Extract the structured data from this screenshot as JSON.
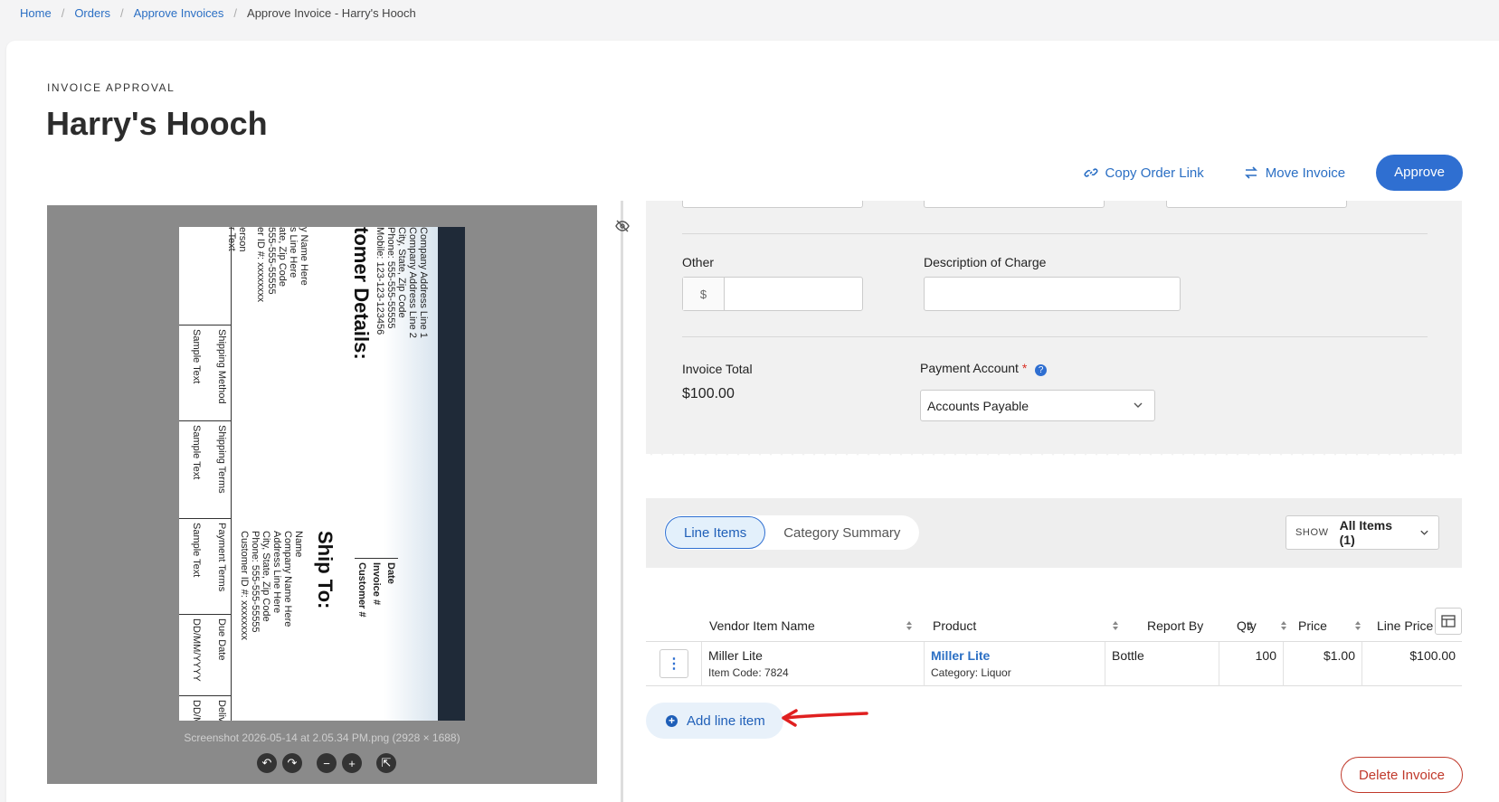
{
  "breadcrumb": {
    "items": [
      "Home",
      "Orders",
      "Approve Invoices"
    ],
    "current": "Approve Invoice - Harry's Hooch"
  },
  "header": {
    "eyebrow": "INVOICE APPROVAL",
    "title": "Harry's Hooch"
  },
  "actions": {
    "copy_link": "Copy Order Link",
    "move_invoice": "Move Invoice",
    "approve": "Approve"
  },
  "viewer": {
    "caption": "Screenshot 2026-05-14 at 2.05.34 PM.png (2928 × 1688)",
    "doc_heading_1": "tomer Details:",
    "doc_heading_2": "Ship To:",
    "doc_lines_left": [
      "Company Address Line 1",
      "Company Address Line 2",
      "City, State, Zip Code",
      "Phone: 555-555-55555",
      "Mobile: 123-123-123456"
    ],
    "doc_lines_far": [
      "y Name Here",
      "s Line Here",
      "ate, Zip Code",
      "555-555-55555",
      "er ID #: xxxxxxxx",
      "erson",
      "r Text"
    ],
    "doc_ship_lines": [
      "Name",
      "Company Name Here",
      "Address Line Here",
      "City, State, Zip Code",
      "Phone: 555-555-55555",
      "Customer ID #: xxxxxxxx"
    ],
    "doc_boxes": [
      "Date",
      "Invoice #",
      "Customer #"
    ],
    "doc_table": [
      {
        "head": "Shipping Method",
        "val": "Sample Text"
      },
      {
        "head": "Shipping Terms",
        "val": "Sample Text"
      },
      {
        "head": "Payment Terms",
        "val": "Sample Text"
      },
      {
        "head": "Due Date",
        "val": "DD/MM/YYYY"
      },
      {
        "head": "Delivery",
        "val": "DD/MM"
      }
    ]
  },
  "form": {
    "other_label": "Other",
    "currency_symbol": "$",
    "description_label": "Description of Charge",
    "invoice_total_label": "Invoice Total",
    "invoice_total_value": "$100.00",
    "payment_account_label": "Payment Account",
    "required_mark": "*",
    "help_glyph": "?",
    "payment_account_value": "Accounts Payable"
  },
  "tabs": {
    "line_items": "Line Items",
    "category_summary": "Category Summary",
    "show_label": "SHOW",
    "show_value": "All Items (1)"
  },
  "table": {
    "columns": [
      "Vendor Item Name",
      "Product",
      "Report By",
      "Qty",
      "Price",
      "Line Price"
    ],
    "rows": [
      {
        "vendor_item": "Miller Lite",
        "item_code": "Item Code: 7824",
        "product": "Miller Lite",
        "category": "Category: Liquor",
        "report_by": "Bottle",
        "qty": "100",
        "price": "$1.00",
        "line_price": "$100.00"
      }
    ]
  },
  "footer": {
    "add_line_item": "Add line item",
    "delete_invoice": "Delete Invoice"
  },
  "colors": {
    "accent": "#2f6fd1",
    "danger": "#c0392b",
    "annotation_arrow": "#e02020"
  }
}
